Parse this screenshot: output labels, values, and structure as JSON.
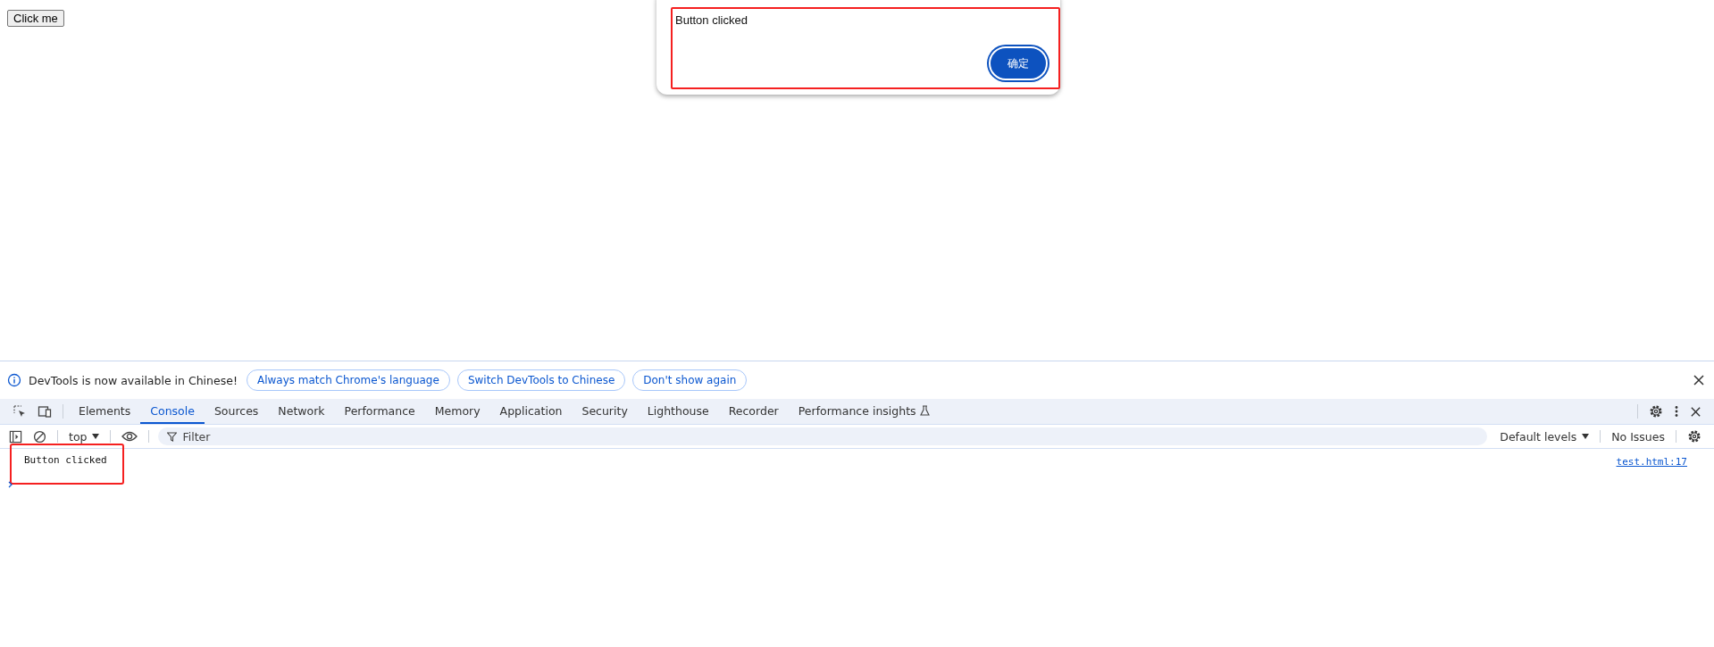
{
  "page": {
    "button": "Click me"
  },
  "dialog": {
    "message": "Button clicked",
    "confirm": "确定"
  },
  "devtools": {
    "banner": {
      "message": "DevTools is now available in Chinese!",
      "buttons": [
        "Always match Chrome's language",
        "Switch DevTools to Chinese",
        "Don't show again"
      ]
    },
    "tabs": [
      {
        "label": "Elements",
        "selected": false,
        "kind": "panel"
      },
      {
        "label": "Console",
        "selected": true,
        "kind": "panel"
      },
      {
        "label": "Sources",
        "selected": false,
        "kind": "panel"
      },
      {
        "label": "Network",
        "selected": false,
        "kind": "panel"
      },
      {
        "label": "Performance",
        "selected": false,
        "kind": "panel"
      },
      {
        "label": "Memory",
        "selected": false,
        "kind": "panel"
      },
      {
        "label": "Application",
        "selected": false,
        "kind": "panel"
      },
      {
        "label": "Security",
        "selected": false,
        "kind": "panel"
      },
      {
        "label": "Lighthouse",
        "selected": false,
        "kind": "panel"
      },
      {
        "label": "Recorder",
        "selected": false,
        "kind": "panel"
      },
      {
        "label": "Performance insights",
        "selected": false,
        "kind": "experimental"
      }
    ],
    "toolbar": {
      "context": "top",
      "filter_placeholder": "Filter",
      "levels": "Default levels",
      "issues": "No Issues"
    },
    "console": [
      {
        "message": "Button clicked",
        "source": "test.html:17"
      }
    ]
  }
}
